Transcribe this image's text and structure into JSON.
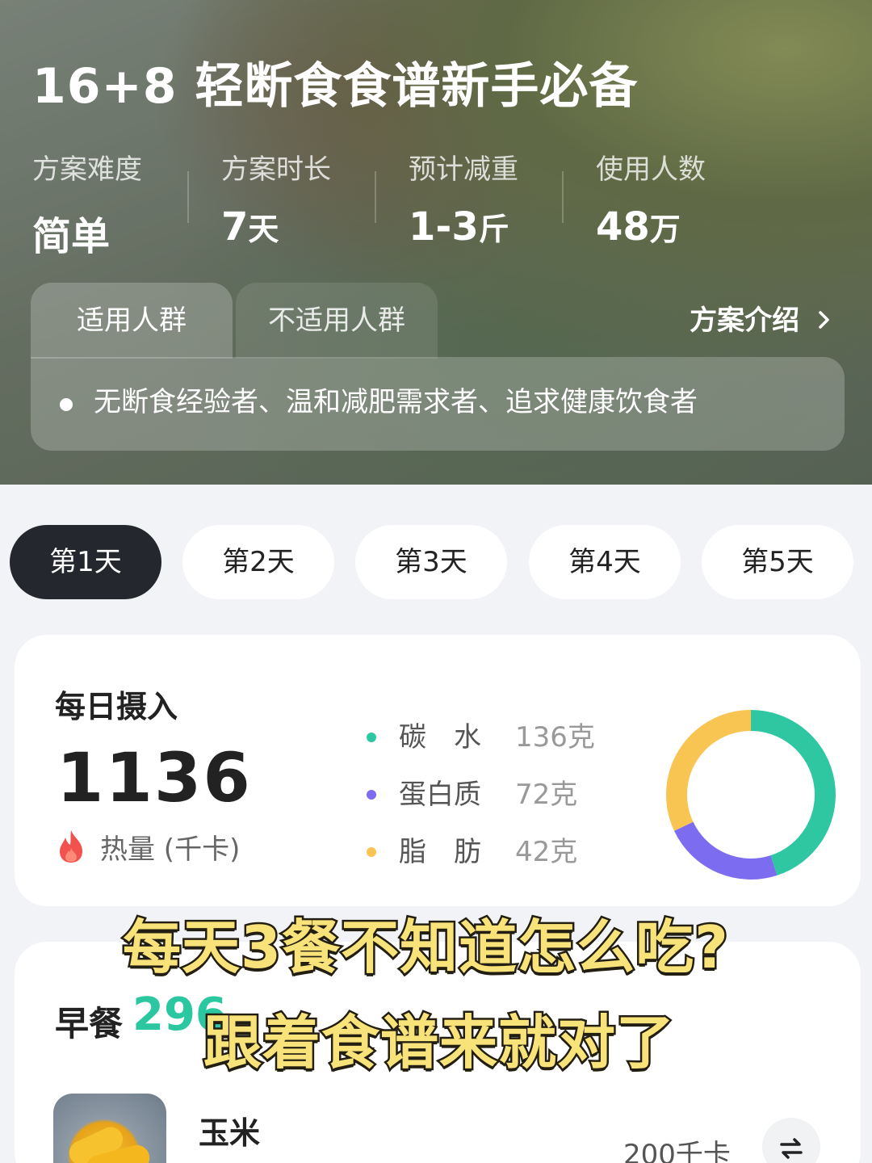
{
  "hero": {
    "title": "16+8 轻断食食谱新手必备",
    "stats": [
      {
        "label": "方案难度",
        "value": "简单",
        "unit": ""
      },
      {
        "label": "方案时长",
        "value": "7",
        "unit": "天"
      },
      {
        "label": "预计减重",
        "value": "1-3",
        "unit": "斤"
      },
      {
        "label": "使用人数",
        "value": "48",
        "unit": "万"
      }
    ],
    "tabs": [
      "适用人群",
      "不适用人群"
    ],
    "intro_link": "方案介绍",
    "intro_chevron": "chevron-right-icon",
    "panel_text": "无断食经验者、温和减肥需求者、追求健康饮食者"
  },
  "days": [
    "第1天",
    "第2天",
    "第3天",
    "第4天",
    "第5天"
  ],
  "intake": {
    "title": "每日摄入",
    "calories": "1136",
    "calorie_label": "热量 (千卡)",
    "macros": [
      {
        "name": "碳　水",
        "value": "136克",
        "color": "#2ec7a2"
      },
      {
        "name": "蛋白质",
        "value": "72克",
        "color": "#7b6cf0"
      },
      {
        "name": "脂　肪",
        "value": "42克",
        "color": "#f9c552"
      }
    ],
    "donut_fractions": [
      0.45,
      0.23,
      0.32
    ]
  },
  "meal": {
    "title": "早餐",
    "calories": "296",
    "food": {
      "name": "玉米",
      "kcal": "200千卡",
      "swap_icon": "swap-icon"
    }
  },
  "captions": [
    "每天3餐不知道怎么吃?",
    "跟着食谱来就对了"
  ],
  "colors": {
    "accent": "#2bc7a0",
    "dark": "#24272d",
    "caption": "#f8e27a"
  }
}
